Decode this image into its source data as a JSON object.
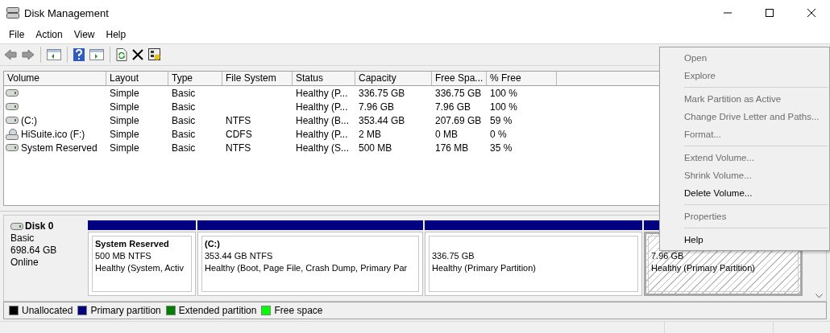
{
  "window": {
    "title": "Disk Management"
  },
  "menu_bar": [
    "File",
    "Action",
    "View",
    "Help"
  ],
  "table": {
    "columns": [
      "Volume",
      "Layout",
      "Type",
      "File System",
      "Status",
      "Capacity",
      "Free Spa...",
      "% Free"
    ],
    "rows": [
      {
        "kind": "drive",
        "cells": [
          "",
          "Simple",
          "Basic",
          "",
          "Healthy (P...",
          "336.75 GB",
          "336.75 GB",
          "100 %"
        ]
      },
      {
        "kind": "drive",
        "cells": [
          "",
          "Simple",
          "Basic",
          "",
          "Healthy (P...",
          "7.96 GB",
          "7.96 GB",
          "100 %"
        ]
      },
      {
        "kind": "drive",
        "cells": [
          "(C:)",
          "Simple",
          "Basic",
          "NTFS",
          "Healthy (B...",
          "353.44 GB",
          "207.69 GB",
          "59 %"
        ]
      },
      {
        "kind": "cd",
        "cells": [
          "HiSuite.ico (F:)",
          "Simple",
          "Basic",
          "CDFS",
          "Healthy (P...",
          "2 MB",
          "0 MB",
          "0 %"
        ]
      },
      {
        "kind": "drive",
        "cells": [
          "System Reserved",
          "Simple",
          "Basic",
          "NTFS",
          "Healthy (S...",
          "500 MB",
          "176 MB",
          "35 %"
        ]
      }
    ]
  },
  "disk": {
    "name": "Disk 0",
    "type": "Basic",
    "size": "698.64 GB",
    "state": "Online",
    "partitions": [
      {
        "kind": "primary",
        "selected": false,
        "name": "System Reserved",
        "size": "500 MB NTFS",
        "status": "Healthy (System, Activ"
      },
      {
        "kind": "primary",
        "selected": false,
        "name": "(C:)",
        "size": "353.44 GB NTFS",
        "status": "Healthy (Boot, Page File, Crash Dump, Primary Par"
      },
      {
        "kind": "primary",
        "selected": false,
        "size": "336.75 GB",
        "status": "Healthy (Primary Partition)"
      },
      {
        "kind": "primary",
        "selected": true,
        "size": "7.96 GB",
        "status": "Healthy (Primary Partition)"
      }
    ]
  },
  "legend": [
    {
      "label": "Unallocated",
      "color": "#000000"
    },
    {
      "label": "Primary partition",
      "color": "#000080"
    },
    {
      "label": "Extended partition",
      "color": "#008000"
    },
    {
      "label": "Free space",
      "color": "#00ff00"
    }
  ],
  "context_menu": [
    [
      {
        "label": "Open",
        "disabled": true
      },
      {
        "label": "Explore",
        "disabled": true
      }
    ],
    [
      {
        "label": "Mark Partition as Active",
        "disabled": true
      },
      {
        "label": "Change Drive Letter and Paths...",
        "disabled": true
      },
      {
        "label": "Format...",
        "disabled": true
      }
    ],
    [
      {
        "label": "Extend Volume...",
        "disabled": true
      },
      {
        "label": "Shrink Volume...",
        "disabled": true
      },
      {
        "label": "Delete Volume...",
        "disabled": false
      }
    ],
    [
      {
        "label": "Properties",
        "disabled": true
      }
    ],
    [
      {
        "label": "Help",
        "disabled": false
      }
    ]
  ]
}
